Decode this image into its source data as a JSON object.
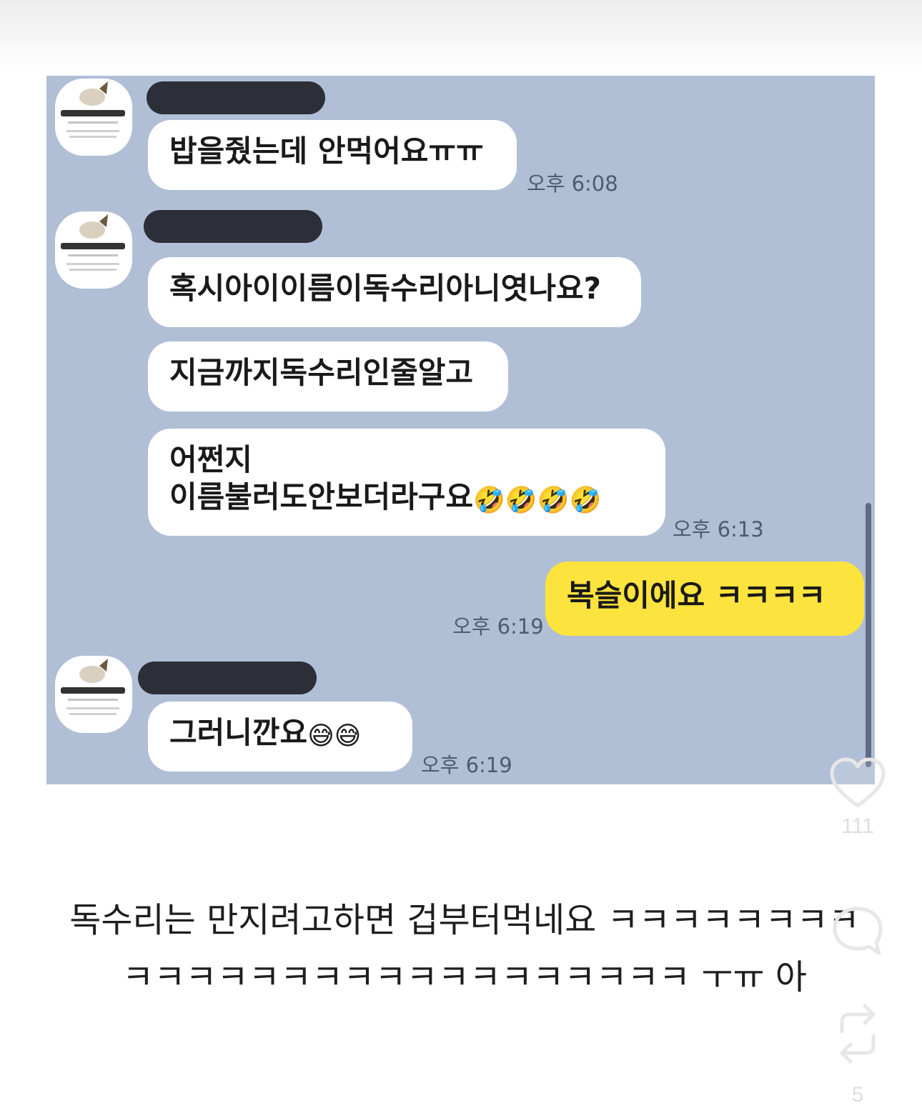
{
  "chat": {
    "messages": [
      {
        "sender": "other",
        "lines": [
          "밥을줬는데 안먹어요ㅠㅠ"
        ],
        "time": "오후 6:08"
      },
      {
        "sender": "other",
        "lines": [
          "혹시아이이름이독수리아니엿나요?"
        ]
      },
      {
        "sender": "other",
        "lines": [
          "지금까지독수리인줄알고"
        ]
      },
      {
        "sender": "other",
        "lines": [
          "어쩐지",
          "이름불러도안보더라구요"
        ],
        "emoji": "🤣🤣🤣🤣",
        "time": "오후 6:13"
      },
      {
        "sender": "me",
        "lines": [
          "복슬이에요 ㅋㅋㅋㅋ"
        ],
        "time": "오후 6:19"
      },
      {
        "sender": "other",
        "lines": [
          "그러니깐요"
        ],
        "emoji": "😅😅",
        "time": "오후 6:19"
      }
    ]
  },
  "caption": {
    "line1": "독수리는 만지려고하면 겁부터먹네요 ㅋㅋㅋㅋㅋㅋㅋㅋ",
    "line2": "ㅋㅋㅋㅋㅋㅋㅋㅋㅋㅋㅋㅋㅋㅋㅋㅋㅋㅋ ㅜㅠ 아"
  },
  "actions": {
    "like": {
      "icon": "heart-icon",
      "count": "111"
    },
    "comment": {
      "icon": "comment-icon"
    },
    "repost": {
      "icon": "repost-icon",
      "count": "5"
    }
  },
  "colors": {
    "chat_background": "#b0bfd6",
    "my_bubble": "#fde33d",
    "other_bubble": "#ffffff"
  }
}
